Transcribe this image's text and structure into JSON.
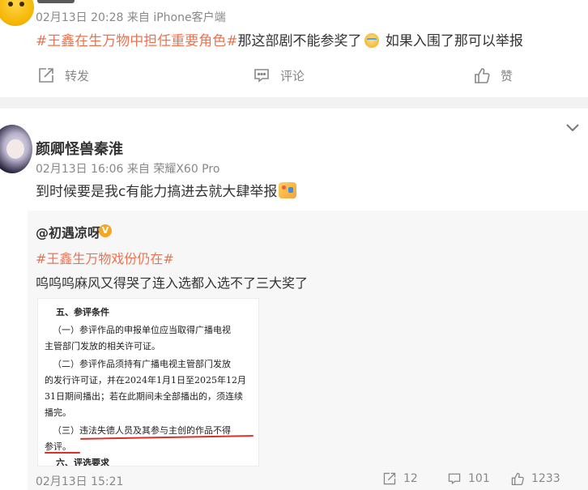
{
  "post1": {
    "meta": "02月13日 20:28  来自 iPhone客户端",
    "hashtag": "#王鑫在生万物中担任重要角色#",
    "text_before_emoji": "那这部剧不能参奖了",
    "text_after_emoji": " 如果入围了那可以举报",
    "actions": {
      "repost": "转发",
      "comment": "评论",
      "like": "赞"
    }
  },
  "post2": {
    "author": "颜卿怪兽秦淮",
    "meta": "02月13日 16:06  来自 荣耀X60 Pro",
    "text": "到时候要是我c有能力搞进去就大肆举报",
    "repost": {
      "author": "@初遇凉呀",
      "badge": "V",
      "hashtag": "#王鑫生万物戏份仍在#",
      "text": "呜呜呜麻风又得哭了连入选都入选不了三大奖了",
      "document_lines": [
        "五、参评条件",
        "（一）参评作品的申报单位应当取得广播电视",
        "主管部门发放的相关许可证。",
        "（二）参评作品须持有广播电视主管部门发放",
        "的发行许可证，并在2024年1月1日至2025年12月",
        "31日期间播出；若在此期间未全部播出的，须连续",
        "播完。",
        "（三）违法失德人员及其参与主创的作品不得",
        "参评。",
        "六、评选要求"
      ],
      "time": "02月13日 15:21",
      "counts": {
        "reposts": "12",
        "comments": "101",
        "likes": "1233"
      }
    }
  },
  "colors": {
    "hashtag": "#eb7350",
    "meta_gray": "#888888",
    "underline_red": "#d9302c",
    "verified_badge": "#f5a623"
  }
}
